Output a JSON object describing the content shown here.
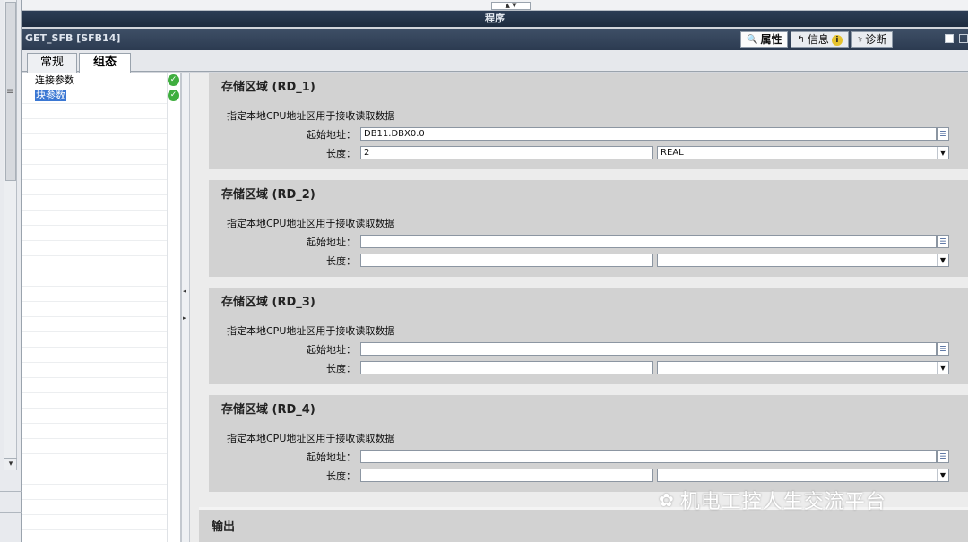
{
  "window": {
    "title": "程序",
    "instance_label": "GET_SFB [SFB14]"
  },
  "inspector_tabs": [
    {
      "label": "属性",
      "icon": "properties-icon"
    },
    {
      "label": "信息",
      "icon": "info-icon"
    },
    {
      "label": "诊断",
      "icon": "diagnostics-icon"
    }
  ],
  "tabs": [
    {
      "label": "常规"
    },
    {
      "label": "组态"
    }
  ],
  "nav": {
    "items": [
      {
        "label": "连接参数",
        "status": "ok"
      },
      {
        "label": "块参数",
        "status": "ok",
        "selected": true
      }
    ]
  },
  "sections": [
    {
      "title": "存储区域 (RD_1)",
      "desc": "指定本地CPU地址区用于接收读取数据",
      "start_label": "起始地址：",
      "start_value": "DB11.DBX0.0",
      "length_label": "长度：",
      "length_value": "2",
      "type_value": "REAL"
    },
    {
      "title": "存储区域 (RD_2)",
      "desc": "指定本地CPU地址区用于接收读取数据",
      "start_label": "起始地址：",
      "start_value": "",
      "length_label": "长度：",
      "length_value": "",
      "type_value": ""
    },
    {
      "title": "存储区域 (RD_3)",
      "desc": "指定本地CPU地址区用于接收读取数据",
      "start_label": "起始地址：",
      "start_value": "",
      "length_label": "长度：",
      "length_value": "",
      "type_value": ""
    },
    {
      "title": "存储区域 (RD_4)",
      "desc": "指定本地CPU地址区用于接收读取数据",
      "start_label": "起始地址：",
      "start_value": "",
      "length_label": "长度：",
      "length_value": "",
      "type_value": ""
    }
  ],
  "output": {
    "title": "输出"
  },
  "watermark": {
    "text": "机电工控人生交流平台"
  }
}
